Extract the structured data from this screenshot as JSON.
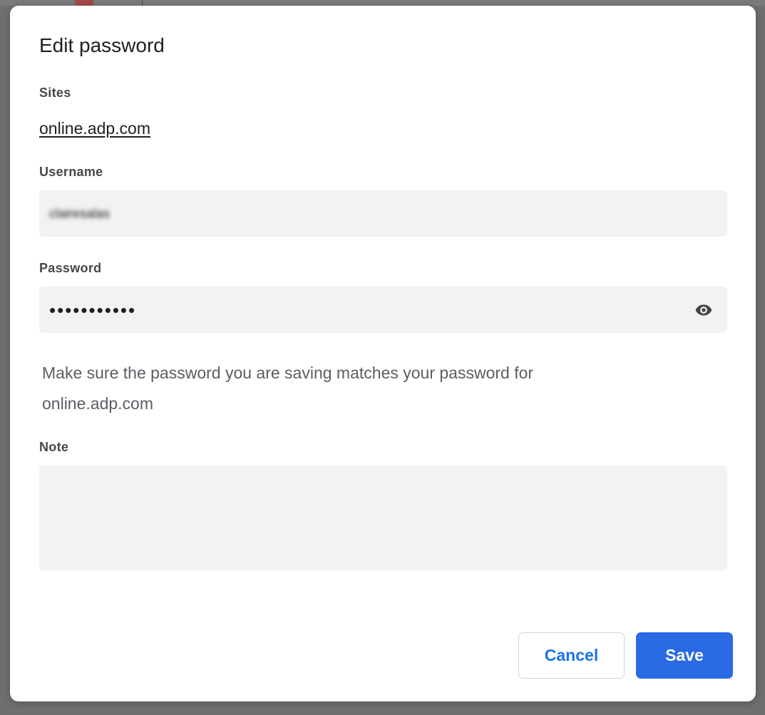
{
  "dialog": {
    "title": "Edit password",
    "sites_label": "Sites",
    "site": "online.adp.com",
    "username_label": "Username",
    "username_value": "clairesalas",
    "password_label": "Password",
    "password_masked": "•••••••••••",
    "show_password_icon": "eye-icon",
    "help_text_line1": "Make sure the password you are saving matches your password for",
    "help_text_line2": "online.adp.com",
    "note_label": "Note",
    "note_value": "",
    "cancel_label": "Cancel",
    "save_label": "Save"
  },
  "colors": {
    "accent": "#2a6ae4",
    "link_blue": "#1a73e8",
    "input_bg": "#f1f2f4",
    "overlay": "#6f6f6f"
  }
}
